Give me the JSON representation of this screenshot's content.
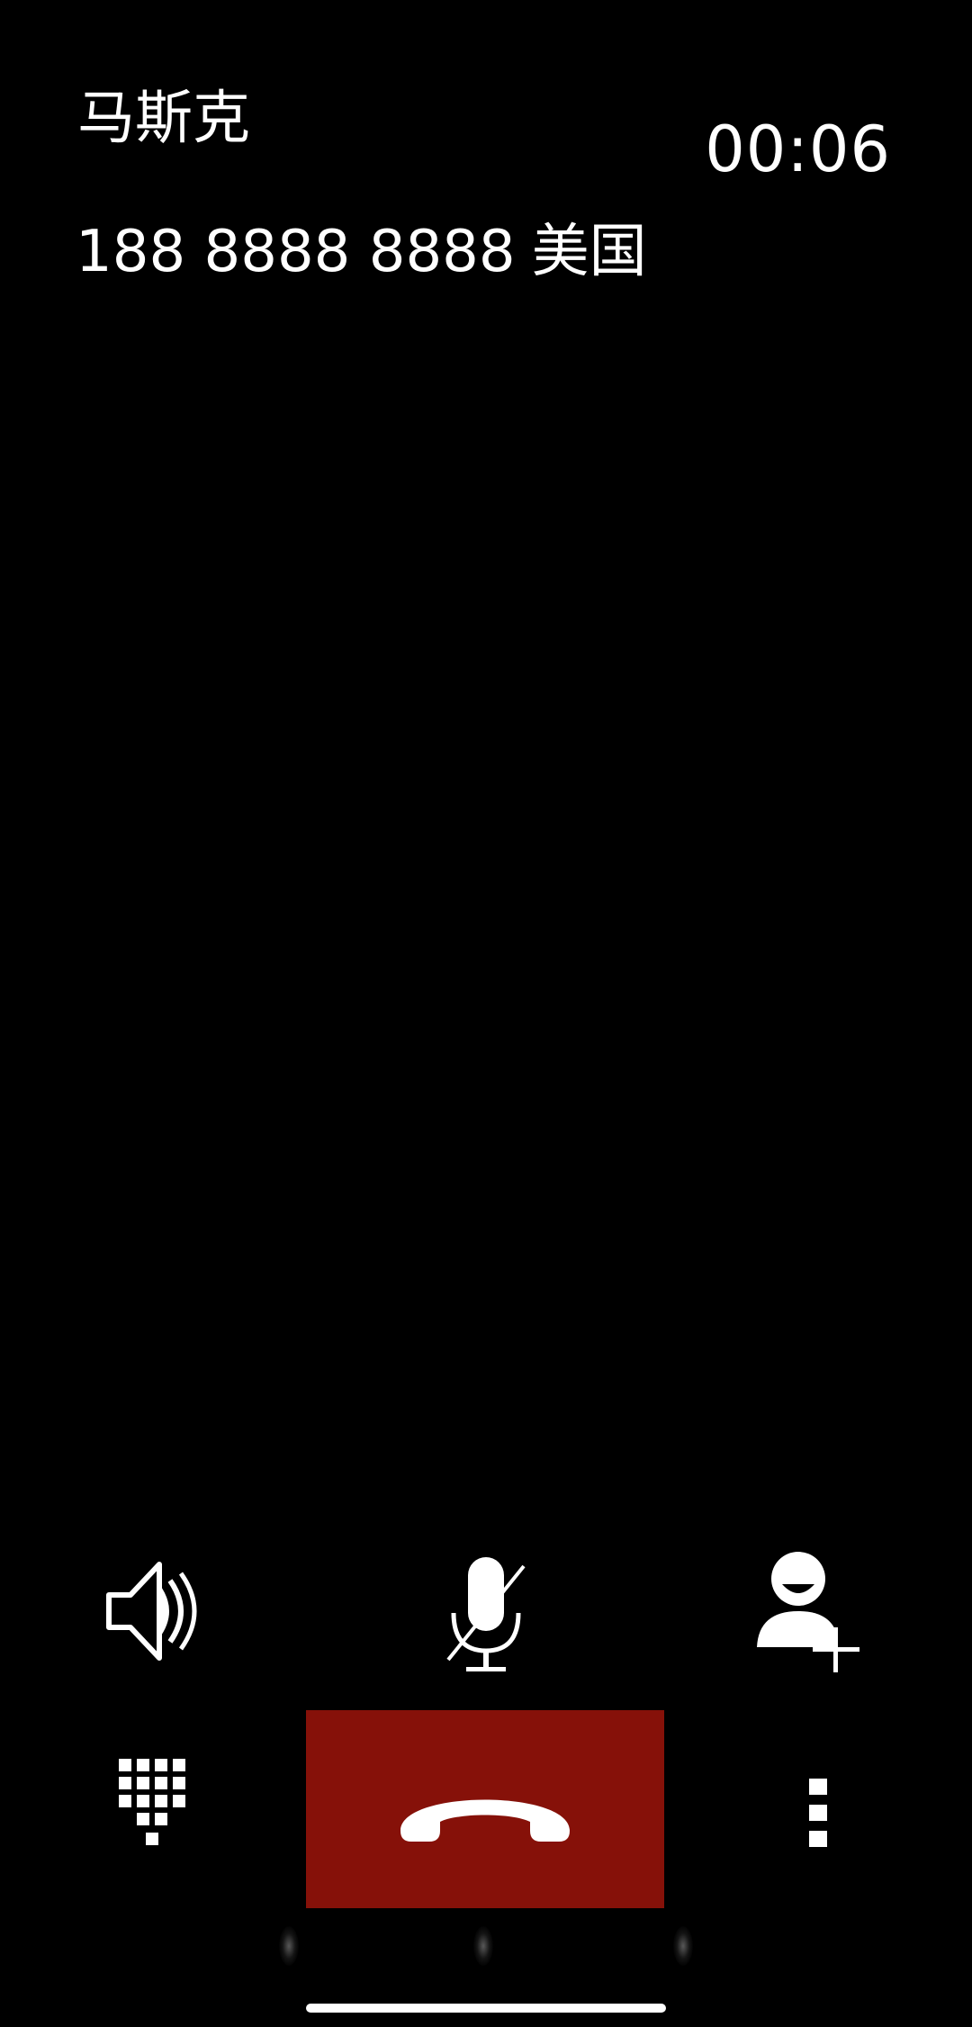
{
  "call": {
    "caller_name": "马斯克",
    "timer": "00:06",
    "phone_number": "188 8888 8888",
    "region": "美国"
  },
  "controls": {
    "speaker_icon": "speaker-icon",
    "mute_icon": "microphone-mute-icon",
    "add_contact_icon": "add-contact-icon",
    "dialpad_icon": "dialpad-icon",
    "end_call_icon": "end-call-icon",
    "more_icon": "more-vertical-icon"
  },
  "colors": {
    "background": "#000000",
    "end_call": "#861109",
    "foreground": "#ffffff"
  }
}
